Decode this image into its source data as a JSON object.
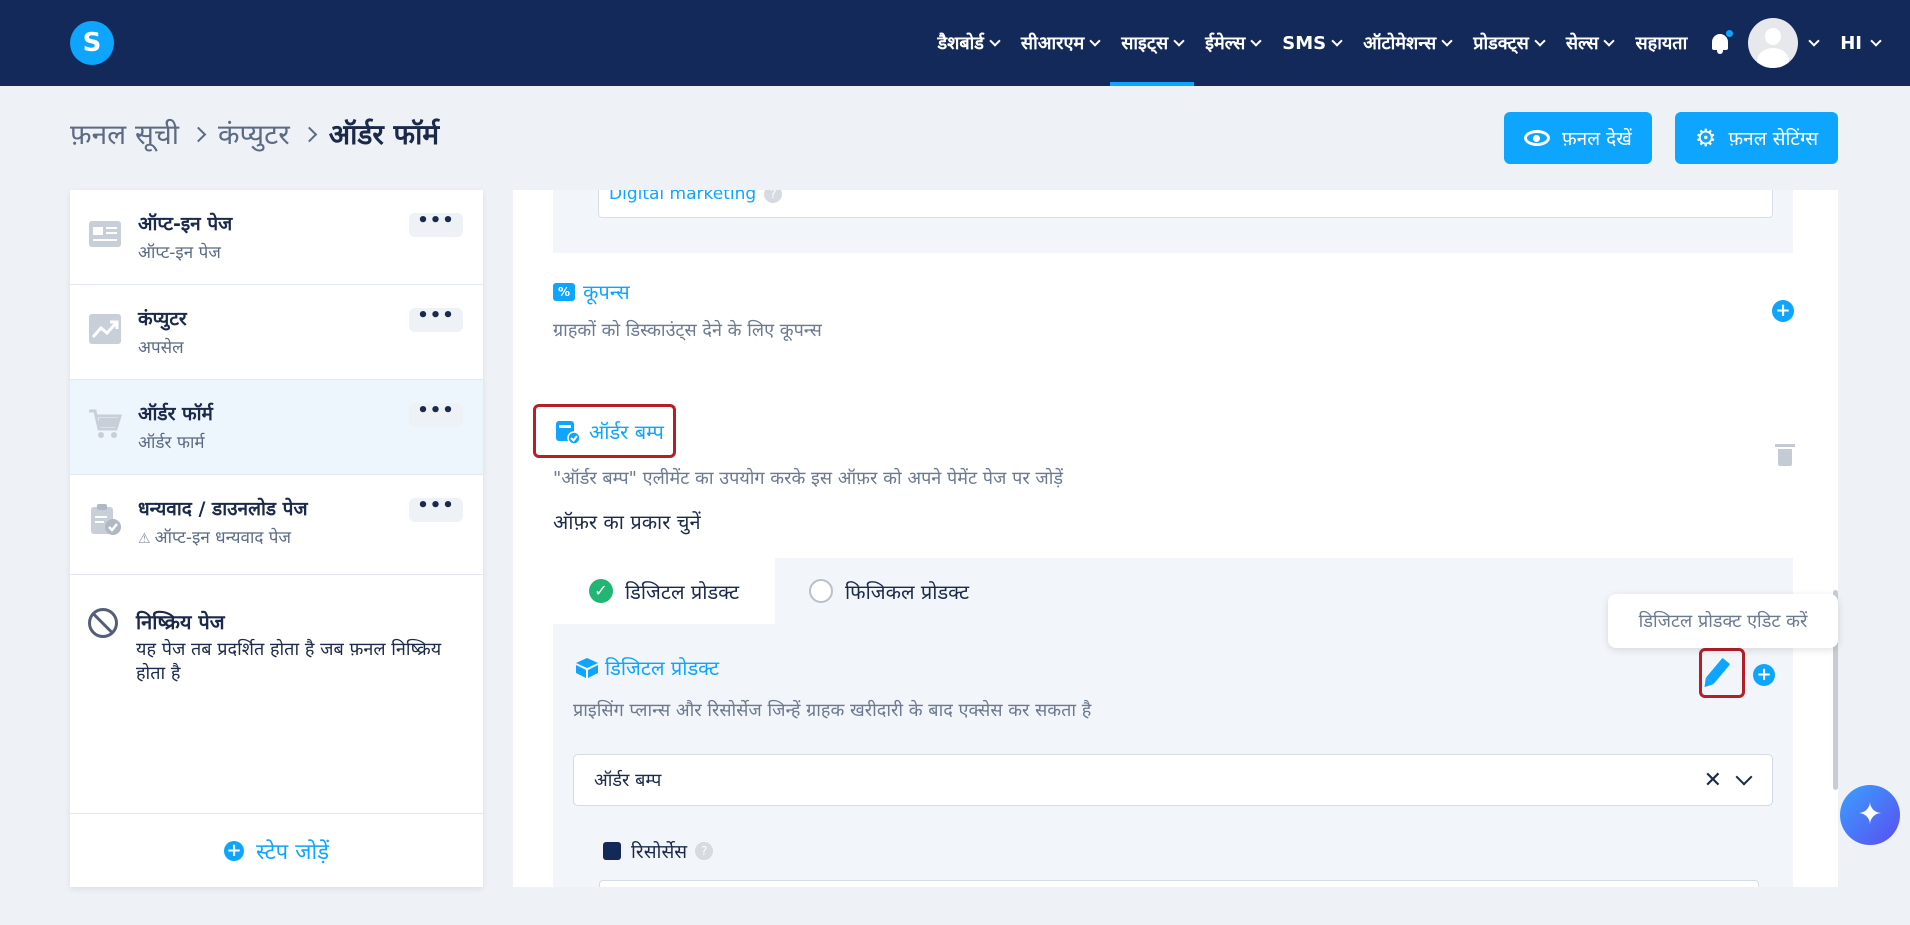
{
  "app": {
    "logo_letter": "S"
  },
  "nav": {
    "items": [
      {
        "label": "डैशबोर्ड",
        "has_dropdown": true,
        "active": false
      },
      {
        "label": "सीआरएम",
        "has_dropdown": true,
        "active": false
      },
      {
        "label": "साइट्स",
        "has_dropdown": true,
        "active": true
      },
      {
        "label": "ईमेल्स",
        "has_dropdown": true,
        "active": false
      },
      {
        "label": "SMS",
        "has_dropdown": true,
        "active": false
      },
      {
        "label": "ऑटोमेशन्स",
        "has_dropdown": true,
        "active": false
      },
      {
        "label": "प्रोडक्ट्स",
        "has_dropdown": true,
        "active": false
      },
      {
        "label": "सेल्स",
        "has_dropdown": true,
        "active": false
      },
      {
        "label": "सहायता",
        "has_dropdown": false,
        "active": false
      }
    ],
    "language": "HI"
  },
  "breadcrumb": {
    "items": [
      "फ़नल सूची",
      "कंप्युटर",
      "ऑर्डर फॉर्म"
    ]
  },
  "header_buttons": {
    "view_funnel": "फ़नल देखें",
    "funnel_settings": "फ़नल सेटिंग्स"
  },
  "sidebar": {
    "steps": [
      {
        "title": "ऑप्ट-इन पेज",
        "subtitle": "ऑप्ट-इन पेज",
        "icon": "optin-page-icon",
        "active": false
      },
      {
        "title": "कंप्युटर",
        "subtitle": "अपसेल",
        "icon": "upsell-chart-icon",
        "active": false
      },
      {
        "title": "ऑर्डर फॉर्म",
        "subtitle": "ऑर्डर फार्म",
        "icon": "cart-icon",
        "active": true
      },
      {
        "title": "धन्यवाद / डाउनलोड पेज",
        "subtitle": "ऑप्ट-इन धन्यवाद पेज",
        "icon": "clipboard-check-icon",
        "active": false,
        "warning": true
      }
    ],
    "more_label": "•••",
    "inactive_page": {
      "title": "निष्क्रिय पेज",
      "description": "यह पेज तब प्रदर्शित होता है जब फ़नल निष्क्रिय होता है"
    },
    "add_step_label": "स्टेप जोड़ें"
  },
  "main": {
    "tag_field": {
      "value": "Digital marketing",
      "help": "?"
    },
    "coupons": {
      "title": "कूपन्स",
      "description": "ग्राहकों को डिस्काउंट्स देने के लिए कूपन्स"
    },
    "order_bump": {
      "title": "ऑर्डर बम्प",
      "description": "\"ऑर्डर बम्प\" एलीमेंट का उपयोग करके इस ऑफ़र को अपने पेमेंट पेज पर जोड़ें"
    },
    "offer_type": {
      "heading": "ऑफ़र का प्रकार चुनें",
      "options": [
        {
          "label": "डिजिटल प्रोडक्ट",
          "selected": true
        },
        {
          "label": "फिजिकल प्रोडक्ट",
          "selected": false
        }
      ]
    },
    "digital_product": {
      "title": "डिजिटल प्रोडक्ट",
      "description": "प्राइसिंग प्लान्स और रिसोर्सेज जिन्हें ग्राहक खरीदारी के बाद एक्सेस कर सकता है",
      "selected_value": "ऑर्डर बम्प",
      "resources_label": "रिसोर्सेस",
      "resources_help": "?"
    },
    "tooltip": "डिजिटल प्रोडक्ट एडिट करें"
  },
  "colors": {
    "navbar": "#13295a",
    "accent": "#0ea5ff",
    "highlight": "#b3202a",
    "success": "#22b573"
  }
}
